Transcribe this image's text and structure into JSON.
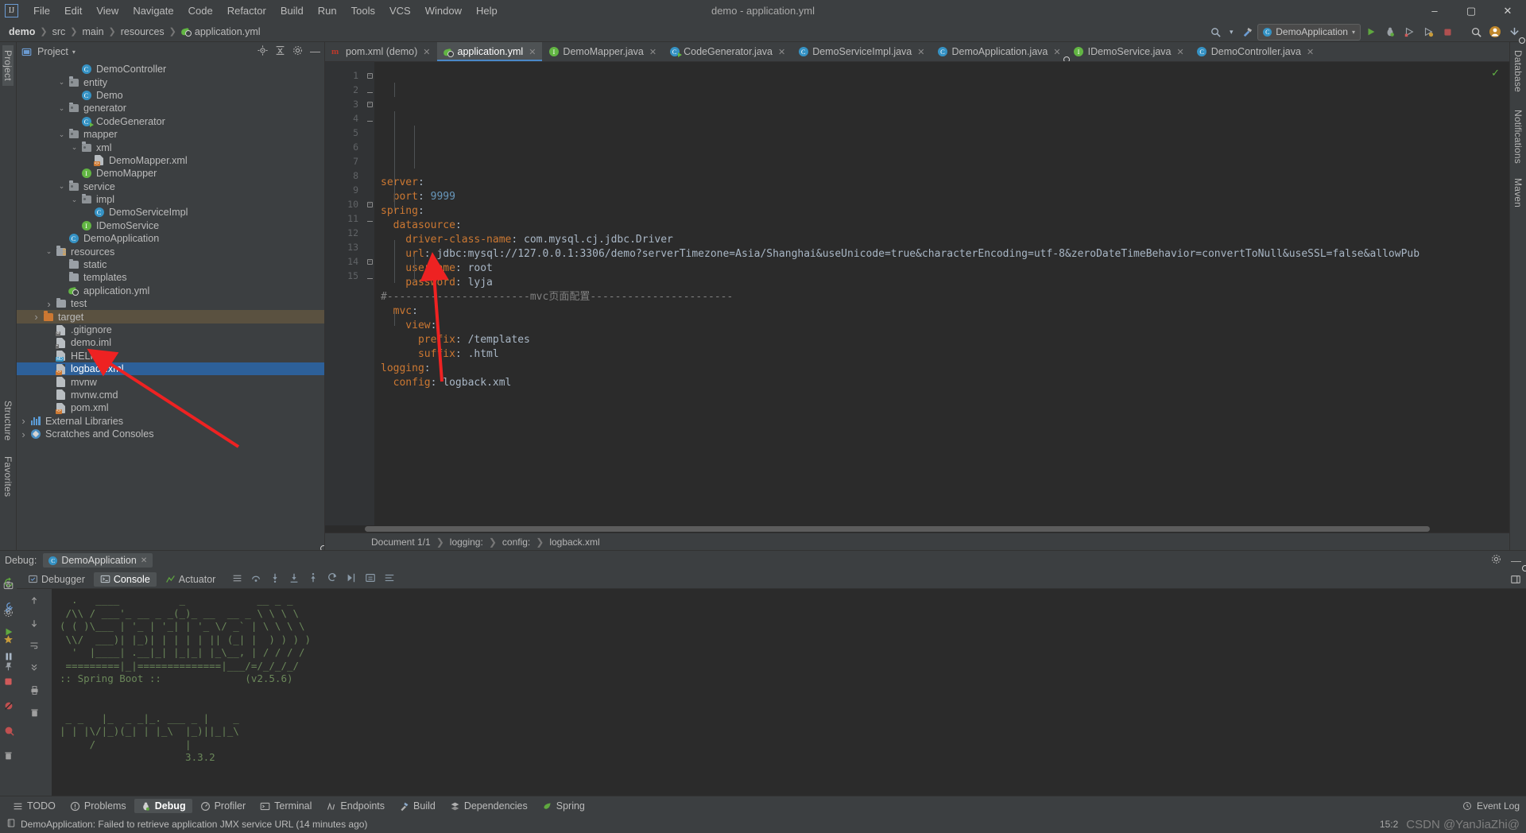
{
  "window": {
    "title": "demo - application.yml",
    "logo": "ij-logo",
    "minimize": "–",
    "maximize": "▢",
    "close": "✕"
  },
  "menubar": {
    "items": [
      "File",
      "Edit",
      "View",
      "Navigate",
      "Code",
      "Refactor",
      "Build",
      "Run",
      "Tools",
      "VCS",
      "Window",
      "Help"
    ]
  },
  "navbar": {
    "breadcrumbs": [
      "demo",
      "src",
      "main",
      "resources",
      "application.yml"
    ],
    "run_config": "DemoApplication",
    "icons": [
      "run-icon",
      "debug-icon",
      "run-with-coverage-icon",
      "profiler-icon",
      "stop-icon",
      "search-icon",
      "account-icon",
      "updates-icon"
    ]
  },
  "left_strip": {
    "labels": [
      "Project",
      "Structure",
      "Favorites"
    ],
    "bottom_icons": [
      "camera-icon",
      "settings-icon",
      "star-icon",
      "pin-icon"
    ]
  },
  "right_strip": {
    "labels": [
      "Database",
      "Maven",
      "Notifications"
    ]
  },
  "project_panel": {
    "title": "Project",
    "header_icons": [
      "locate-icon",
      "collapse-all-icon",
      "expand-icon",
      "settings-gear-icon",
      "hide-icon"
    ],
    "tree": [
      {
        "depth": 4,
        "arrow": "",
        "icon": "class-icon",
        "label": "DemoController",
        "state": ""
      },
      {
        "depth": 3,
        "arrow": "v",
        "icon": "package-icon",
        "label": "entity",
        "state": ""
      },
      {
        "depth": 4,
        "arrow": "",
        "icon": "class-icon",
        "label": "Demo",
        "state": ""
      },
      {
        "depth": 3,
        "arrow": "v",
        "icon": "package-icon",
        "label": "generator",
        "state": ""
      },
      {
        "depth": 4,
        "arrow": "",
        "icon": "class-run-icon",
        "label": "CodeGenerator",
        "state": ""
      },
      {
        "depth": 3,
        "arrow": "v",
        "icon": "package-icon",
        "label": "mapper",
        "state": ""
      },
      {
        "depth": 4,
        "arrow": "v",
        "icon": "package-icon",
        "label": "xml",
        "state": ""
      },
      {
        "depth": 5,
        "arrow": "",
        "icon": "xml-file-icon",
        "label": "DemoMapper.xml",
        "state": ""
      },
      {
        "depth": 4,
        "arrow": "",
        "icon": "interface-icon",
        "label": "DemoMapper",
        "state": ""
      },
      {
        "depth": 3,
        "arrow": "v",
        "icon": "package-icon",
        "label": "service",
        "state": ""
      },
      {
        "depth": 4,
        "arrow": "v",
        "icon": "package-icon",
        "label": "impl",
        "state": ""
      },
      {
        "depth": 5,
        "arrow": "",
        "icon": "class-icon",
        "label": "DemoServiceImpl",
        "state": ""
      },
      {
        "depth": 4,
        "arrow": "",
        "icon": "interface-icon",
        "label": "IDemoService",
        "state": ""
      },
      {
        "depth": 3,
        "arrow": "",
        "icon": "spring-boot-class-icon",
        "label": "DemoApplication",
        "state": ""
      },
      {
        "depth": 2,
        "arrow": "v",
        "icon": "resources-folder-icon",
        "label": "resources",
        "state": ""
      },
      {
        "depth": 3,
        "arrow": "",
        "icon": "folder-icon",
        "label": "static",
        "state": ""
      },
      {
        "depth": 3,
        "arrow": "",
        "icon": "folder-icon",
        "label": "templates",
        "state": ""
      },
      {
        "depth": 3,
        "arrow": "",
        "icon": "yml-file-icon",
        "label": "application.yml",
        "state": ""
      },
      {
        "depth": 2,
        "arrow": ">",
        "icon": "folder-icon",
        "label": "test",
        "state": ""
      },
      {
        "depth": 1,
        "arrow": ">",
        "icon": "target-folder-icon",
        "label": "target",
        "state": "tan"
      },
      {
        "depth": 2,
        "arrow": "",
        "icon": "gitignore-file-icon",
        "label": ".gitignore",
        "state": ""
      },
      {
        "depth": 2,
        "arrow": "",
        "icon": "iml-file-icon",
        "label": "demo.iml",
        "state": ""
      },
      {
        "depth": 2,
        "arrow": "",
        "icon": "md-file-icon",
        "label": "HELP.md",
        "state": ""
      },
      {
        "depth": 2,
        "arrow": "",
        "icon": "xml-file-icon",
        "label": "logback.xml",
        "state": "selected"
      },
      {
        "depth": 2,
        "arrow": "",
        "icon": "file-icon",
        "label": "mvnw",
        "state": ""
      },
      {
        "depth": 2,
        "arrow": "",
        "icon": "file-icon",
        "label": "mvnw.cmd",
        "state": ""
      },
      {
        "depth": 2,
        "arrow": "",
        "icon": "xml-file-icon",
        "label": "pom.xml",
        "state": ""
      },
      {
        "depth": 0,
        "arrow": ">",
        "icon": "library-icon",
        "label": "External Libraries",
        "state": ""
      },
      {
        "depth": 0,
        "arrow": ">",
        "icon": "scratches-icon",
        "label": "Scratches and Consoles",
        "state": ""
      }
    ]
  },
  "editor": {
    "tabs": [
      {
        "label": "pom.xml (demo)",
        "icon": "maven-icon",
        "active": false
      },
      {
        "label": "application.yml",
        "icon": "yml-file-icon",
        "active": true
      },
      {
        "label": "DemoMapper.java",
        "icon": "interface-icon",
        "active": false
      },
      {
        "label": "CodeGenerator.java",
        "icon": "class-run-icon",
        "active": false
      },
      {
        "label": "DemoServiceImpl.java",
        "icon": "class-icon",
        "active": false
      },
      {
        "label": "DemoApplication.java",
        "icon": "spring-boot-class-icon",
        "active": false
      },
      {
        "label": "IDemoService.java",
        "icon": "interface-icon",
        "active": false
      },
      {
        "label": "DemoController.java",
        "icon": "class-icon",
        "active": false
      }
    ],
    "tab_close": "✕",
    "inspection_status": "✓",
    "line_numbers": [
      "1",
      "2",
      "3",
      "4",
      "5",
      "6",
      "7",
      "8",
      "9",
      "10",
      "11",
      "12",
      "13",
      "14",
      "15"
    ],
    "lines": [
      [
        {
          "t": "server",
          "c": "key"
        },
        {
          "t": ":",
          "c": "col"
        }
      ],
      [
        {
          "t": "  port",
          "c": "key"
        },
        {
          "t": ": ",
          "c": "col"
        },
        {
          "t": "9999",
          "c": "num"
        }
      ],
      [
        {
          "t": "spring",
          "c": "key"
        },
        {
          "t": ":",
          "c": "col"
        }
      ],
      [
        {
          "t": "  datasource",
          "c": "key"
        },
        {
          "t": ":",
          "c": "col"
        }
      ],
      [
        {
          "t": "    driver-class-name",
          "c": "key"
        },
        {
          "t": ": ",
          "c": "col"
        },
        {
          "t": "com.mysql.cj.jdbc.Driver",
          "c": "val"
        }
      ],
      [
        {
          "t": "    url",
          "c": "key"
        },
        {
          "t": ": ",
          "c": "col"
        },
        {
          "t": "jdbc:mysql://127.0.0.1:3306/demo?serverTimezone=Asia/Shanghai&useUnicode=true&characterEncoding=utf-8&zeroDateTimeBehavior=convertToNull&useSSL=false&allowPub",
          "c": "val"
        }
      ],
      [
        {
          "t": "    username",
          "c": "key"
        },
        {
          "t": ": ",
          "c": "col"
        },
        {
          "t": "root",
          "c": "val"
        }
      ],
      [
        {
          "t": "    password",
          "c": "key"
        },
        {
          "t": ": ",
          "c": "col"
        },
        {
          "t": "lyja",
          "c": "val"
        }
      ],
      [
        {
          "t": "#-----------------------mvc页面配置-----------------------",
          "c": "cmt"
        }
      ],
      [
        {
          "t": "  mvc",
          "c": "key"
        },
        {
          "t": ":",
          "c": "col"
        }
      ],
      [
        {
          "t": "    view",
          "c": "key"
        },
        {
          "t": ":",
          "c": "col"
        }
      ],
      [
        {
          "t": "      prefix",
          "c": "key"
        },
        {
          "t": ": ",
          "c": "col"
        },
        {
          "t": "/templates",
          "c": "val"
        }
      ],
      [
        {
          "t": "      suffix",
          "c": "key"
        },
        {
          "t": ": ",
          "c": "col"
        },
        {
          "t": ".html",
          "c": "val"
        }
      ],
      [
        {
          "t": "logging",
          "c": "key"
        },
        {
          "t": ":",
          "c": "col"
        }
      ],
      [
        {
          "t": "  config",
          "c": "key"
        },
        {
          "t": ": ",
          "c": "col"
        },
        {
          "t": "logback.xml",
          "c": "val"
        }
      ]
    ],
    "status_breadcrumb": [
      "Document 1/1",
      "logging:",
      "config:",
      "logback.xml"
    ]
  },
  "debug_panel": {
    "title": "Debug:",
    "session": "DemoApplication",
    "session_close": "✕",
    "settings_icon": "gear-icon",
    "minimize_icon": "minimize-icon",
    "tabs": [
      {
        "label": "Debugger",
        "icon": "debugger-icon",
        "active": false
      },
      {
        "label": "Console",
        "icon": "console-icon",
        "active": true
      },
      {
        "label": "Actuator",
        "icon": "actuator-icon",
        "active": false
      }
    ],
    "toolbar_icons": [
      "layout-icon",
      "step-over-icon",
      "step-into-icon",
      "force-step-into-icon",
      "step-out-icon",
      "drop-frame-icon",
      "run-to-cursor-icon",
      "evaluate-icon",
      "wrap-icon"
    ],
    "left_icons": [
      "rerun-icon",
      "settings-wrench-icon",
      "resume-icon",
      "pause-icon",
      "stop-icon",
      "mute-breakpoints-icon",
      "view-breakpoints-icon",
      "trash-icon"
    ],
    "side_icons": [
      "up-arrow-icon",
      "down-arrow-icon",
      "soft-wrap-icon",
      "scroll-to-end-icon",
      "print-icon",
      "clear-all-icon"
    ],
    "console_lines": [
      "  .   ____          _            __ _ _",
      " /\\\\ / ___'_ __ _ _(_)_ __  __ _ \\ \\ \\ \\",
      "( ( )\\___ | '_ | '_| | '_ \\/ _` | \\ \\ \\ \\",
      " \\\\/  ___)| |_)| | | | | || (_| |  ) ) ) )",
      "  '  |____| .__|_| |_|_| |_\\__, | / / / /",
      " =========|_|==============|___/=/_/_/_/"
    ],
    "spring_boot_banner": ":: Spring Boot ::",
    "spring_boot_version": "(v2.5.6)",
    "mybatis_lines": [
      " _ _   |_  _ _|_. ___ _ |    _",
      "| | |\\/|_)(_| | |_\\  |_)||_|_\\",
      "     /               |         ",
      "                     3.3.2"
    ]
  },
  "toolwindow_bar": {
    "items": [
      {
        "label": "TODO",
        "icon": "todo-icon",
        "active": false
      },
      {
        "label": "Problems",
        "icon": "problems-icon",
        "active": false
      },
      {
        "label": "Debug",
        "icon": "debug-icon",
        "active": true
      },
      {
        "label": "Profiler",
        "icon": "profiler-icon",
        "active": false
      },
      {
        "label": "Terminal",
        "icon": "terminal-icon",
        "active": false
      },
      {
        "label": "Endpoints",
        "icon": "endpoints-icon",
        "active": false
      },
      {
        "label": "Build",
        "icon": "build-icon",
        "active": false
      },
      {
        "label": "Dependencies",
        "icon": "dependencies-icon",
        "active": false
      },
      {
        "label": "Spring",
        "icon": "spring-icon",
        "active": false
      }
    ],
    "event_log": "Event Log",
    "event_log_icon": "event-log-icon"
  },
  "statusbar": {
    "message": "DemoApplication: Failed to retrieve application JMX service URL (14 minutes ago)",
    "message_icon": "notification-icon",
    "time": "15:2",
    "watermark": "CSDN @YanJiaZhi@"
  },
  "colors": {
    "accent_blue": "#4a88c7",
    "selection_blue": "#2d6099",
    "panel_bg": "#3c3f41",
    "editor_bg": "#2b2b2b",
    "annotation_red": "#ee2222"
  }
}
